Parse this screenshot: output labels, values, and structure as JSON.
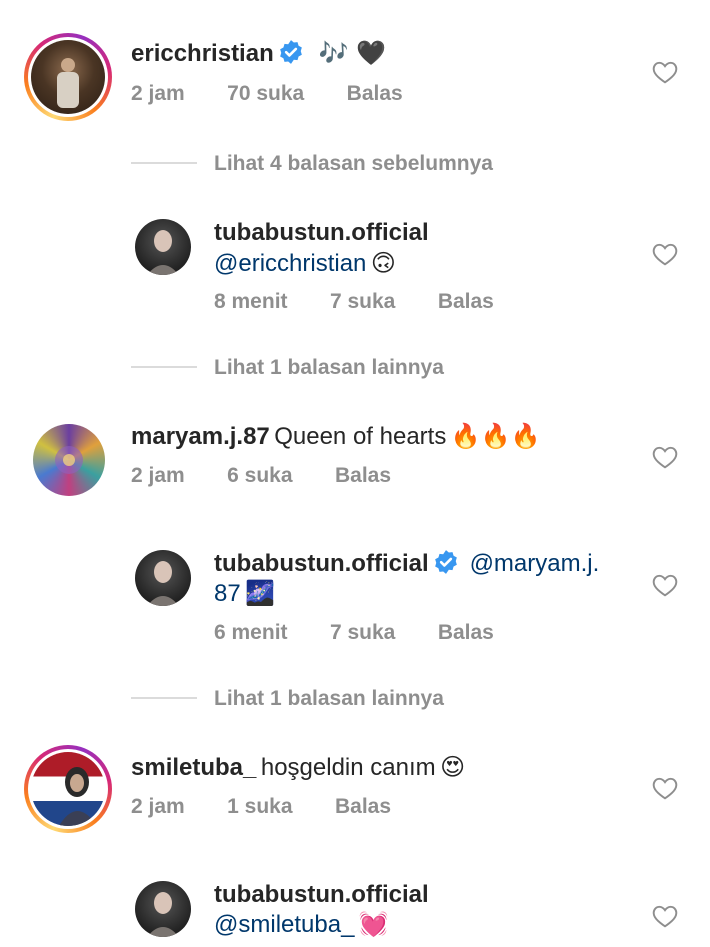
{
  "comments": [
    {
      "username": "ericchristian",
      "verified": true,
      "text": "",
      "emoji": "🎶 🖤",
      "time": "2 jam",
      "likes": "70 suka",
      "reply": "Balas",
      "avatar_ring": true
    },
    {
      "username": "maryam.j.87",
      "verified": false,
      "text": "Queen of hearts",
      "emoji": "🔥🔥🔥",
      "time": "2 jam",
      "likes": "6 suka",
      "reply": "Balas",
      "avatar_ring": false
    },
    {
      "username": "smiletuba_",
      "verified": false,
      "text": "hoşgeldin canım",
      "emoji": "😍",
      "time": "2 jam",
      "likes": "1 suka",
      "reply": "Balas",
      "avatar_ring": true
    }
  ],
  "replies": [
    {
      "username": "tubabustun.official",
      "verified": false,
      "mention": "@ericchristian",
      "emoji": "🙃",
      "time": "8 menit",
      "likes": "7 suka",
      "reply": "Balas"
    },
    {
      "username": "tubabustun.official",
      "verified": true,
      "mention_line1": "@maryam.j.",
      "mention_line2": "87",
      "emoji": "🌌",
      "time": "6 menit",
      "likes": "7 suka",
      "reply": "Balas"
    },
    {
      "username": "tubabustun.official",
      "verified": false,
      "mention": "@smiletuba_",
      "emoji": "💓"
    }
  ],
  "view_more": [
    "Lihat 4 balasan sebelumnya",
    "Lihat 1 balasan lainnya",
    "Lihat 1 balasan lainnya"
  ],
  "colors": {
    "verified_blue": "#3897f0",
    "mention_blue": "#00376b",
    "meta_gray": "#8e8e8e"
  }
}
